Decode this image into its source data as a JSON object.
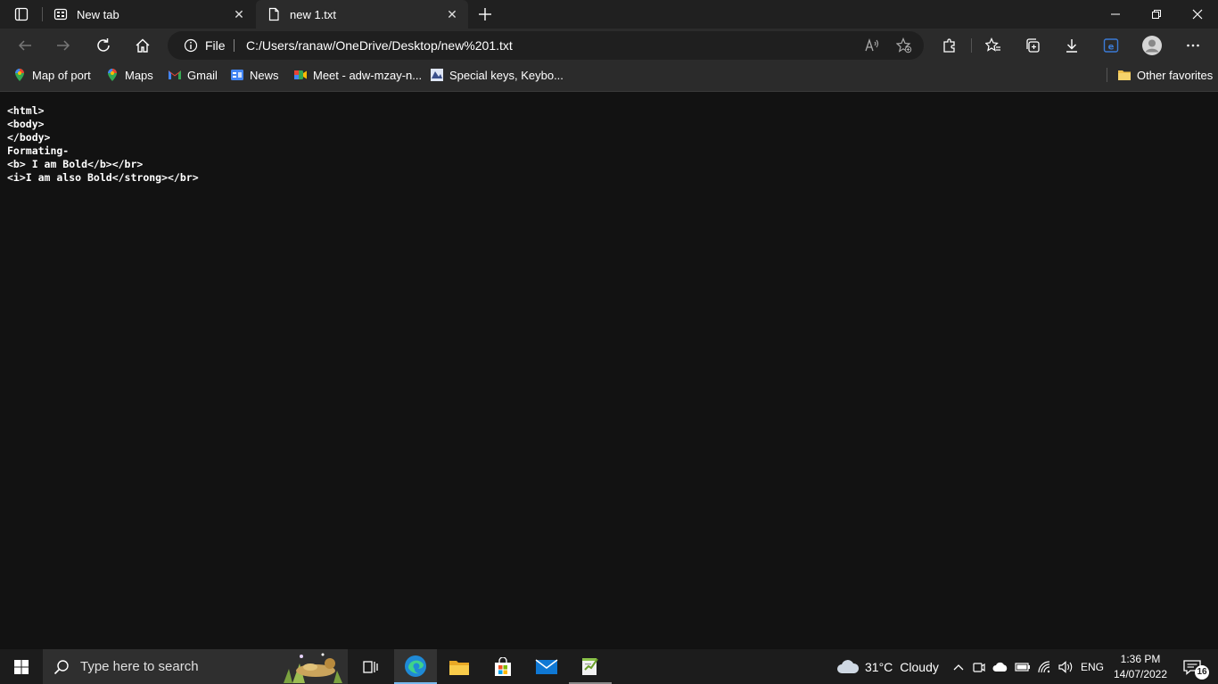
{
  "browser": {
    "tabs": [
      {
        "label": "New tab",
        "icon": "new-tab-page-icon"
      },
      {
        "label": "new 1.txt",
        "icon": "document-icon"
      }
    ],
    "address": {
      "scheme_label": "File",
      "url": "C:/Users/ranaw/OneDrive/Desktop/new%201.txt"
    },
    "bookmarks": [
      {
        "label": "Map of port",
        "icon": "maps-pin-icon"
      },
      {
        "label": "Maps",
        "icon": "maps-pin-icon"
      },
      {
        "label": "Gmail",
        "icon": "gmail-icon"
      },
      {
        "label": "News",
        "icon": "news-icon"
      },
      {
        "label": "Meet - adw-mzay-n...",
        "icon": "meet-icon"
      },
      {
        "label": "Special keys, Keybo...",
        "icon": "site-icon"
      }
    ],
    "other_favorites": "Other favorites"
  },
  "document": {
    "lines": [
      "<html>",
      "<body>",
      "</body>",
      "Formating-",
      "<b> I am Bold</b></br>",
      "<i>I am also Bold</strong></br>"
    ]
  },
  "taskbar": {
    "search_placeholder": "Type here to search",
    "weather": {
      "temp": "31°C",
      "condition": "Cloudy"
    },
    "language": "ENG",
    "time": "1:36 PM",
    "date": "14/07/2022",
    "notifications": "16"
  },
  "colors": {
    "accent": "#3b7bd6",
    "background": "#121212",
    "chrome": "#2b2b2b"
  }
}
